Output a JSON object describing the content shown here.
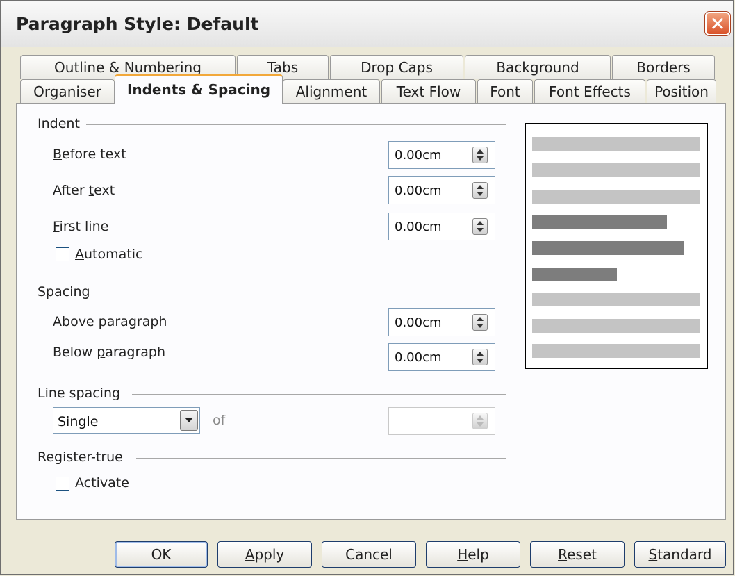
{
  "window": {
    "title": "Paragraph Style: Default",
    "close_glyph": "✕"
  },
  "tabs_row1": [
    "Outline & Numbering",
    "Tabs",
    "Drop Caps",
    "Background",
    "Borders"
  ],
  "tabs_row2": [
    "Organiser",
    "Indents & Spacing",
    "Alignment",
    "Text Flow",
    "Font",
    "Font Effects",
    "Position"
  ],
  "active_tab": "Indents & Spacing",
  "indent": {
    "heading": "Indent",
    "before_text": {
      "pre": "",
      "key": "B",
      "post": "efore text",
      "value": "0.00cm"
    },
    "after_text": {
      "pre": "After ",
      "key": "t",
      "post": "ext",
      "value": "0.00cm"
    },
    "first_line": {
      "pre": "",
      "key": "F",
      "post": "irst line",
      "value": "0.00cm"
    },
    "automatic": {
      "pre": "",
      "key": "A",
      "post": "utomatic",
      "checked": false
    }
  },
  "spacing": {
    "heading": "Spacing",
    "above": {
      "pre": "Ab",
      "key": "o",
      "post": "ve paragraph",
      "value": "0.00cm"
    },
    "below": {
      "pre": "Below ",
      "key": "p",
      "post": "aragraph",
      "value": "0.00cm"
    }
  },
  "line_spacing": {
    "heading": "Line spacing",
    "selected": "Single",
    "of_label": "of",
    "value": ""
  },
  "register_true": {
    "heading": "Register-true",
    "activate": {
      "pre": "A",
      "key": "c",
      "post": "tivate",
      "checked": false
    }
  },
  "buttons": {
    "ok": {
      "pre": "OK",
      "key": "",
      "post": ""
    },
    "apply": {
      "pre": "",
      "key": "A",
      "post": "pply"
    },
    "cancel": {
      "pre": "Cancel",
      "key": "",
      "post": ""
    },
    "help": {
      "pre": "",
      "key": "H",
      "post": "elp"
    },
    "reset": {
      "pre": "",
      "key": "R",
      "post": "eset"
    },
    "standard": {
      "pre": "",
      "key": "S",
      "post": "tandard"
    }
  },
  "colors": {
    "preview_light": "#c4c4c4",
    "preview_dark": "#7d7d7d",
    "tab_accent": "#f2a83a",
    "close_red": "#d9522a"
  }
}
